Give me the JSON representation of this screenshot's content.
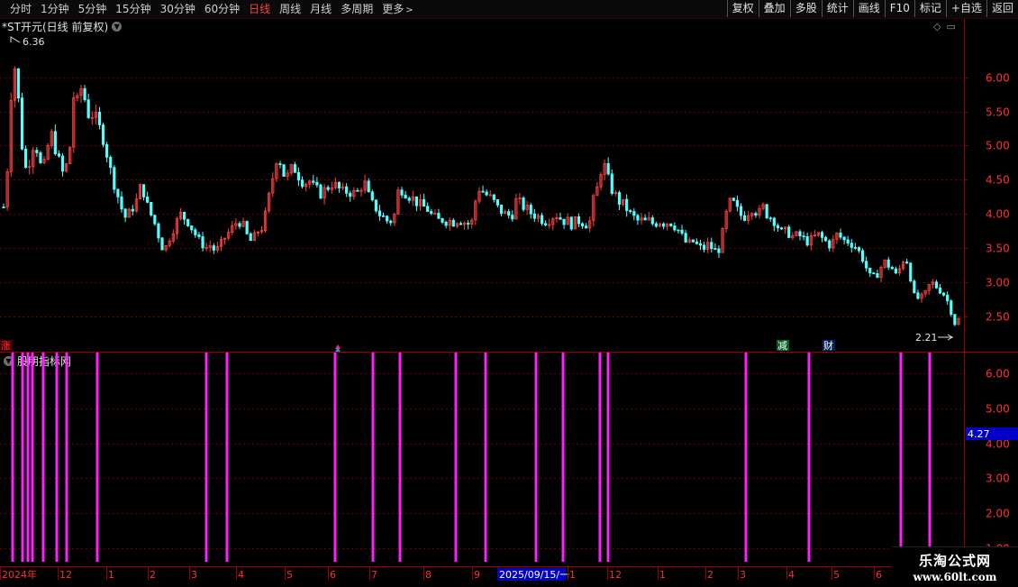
{
  "toolbar": {
    "left_items": [
      "分时",
      "1分钟",
      "5分钟",
      "15分钟",
      "30分钟",
      "60分钟",
      "日线",
      "周线",
      "月线",
      "多周期",
      "更多"
    ],
    "active_index": 6,
    "more_chevron": ">",
    "right_buttons": [
      "复权",
      "叠加",
      "多股",
      "统计",
      "画线",
      "F10",
      "标记",
      "+自选",
      "返回"
    ]
  },
  "chart_title": "*ST开元(日线 前复权)",
  "indicator_title": "股朋指标网",
  "price_axis": {
    "ticks": [
      "6.00",
      "5.50",
      "5.00",
      "4.50",
      "4.00",
      "3.50",
      "3.00",
      "2.50"
    ],
    "tick_values": [
      6.0,
      5.5,
      5.0,
      4.5,
      4.0,
      3.5,
      3.0,
      2.5
    ],
    "range": [
      2.1,
      6.75
    ]
  },
  "indicator_axis": {
    "ticks": [
      "6.00",
      "5.00",
      "4.00",
      "3.00",
      "2.00",
      "1.00"
    ],
    "tick_values": [
      6,
      5,
      4,
      3,
      2,
      1
    ],
    "range": [
      0.6,
      6.6
    ],
    "current_value": "4.27",
    "current_numeric": 4.27
  },
  "annotations": {
    "high_label": "6.36",
    "low_label": "2.21",
    "markers": [
      {
        "text": "涨",
        "color": "#ff3030",
        "bg": "#400000"
      },
      {
        "text": "减",
        "color": "#ffffff",
        "bg": "#006020"
      },
      {
        "text": "财",
        "color": "#ffffff",
        "bg": "#002060"
      }
    ]
  },
  "date_axis": {
    "labels": [
      "2024年",
      "12",
      "1",
      "2",
      "3",
      "4",
      "5",
      "6",
      "7",
      "8",
      "9",
      "2025/09/15/一",
      "1",
      "12",
      "1",
      "2",
      "3",
      "4",
      "5",
      "6"
    ]
  },
  "watermark": {
    "line1": "乐淘公式网",
    "line2": "www.60lt.com"
  },
  "colors": {
    "up": "#ff4040",
    "down": "#54ffff",
    "grid": "#6a0000",
    "signal": "#ff20ff",
    "axis_text": "#ff3030",
    "value_box": "#0000c8"
  },
  "chart_data": {
    "type": "candlestick",
    "price_series": [
      4.1,
      4.7,
      5.9,
      6.2,
      5.5,
      4.8,
      4.6,
      4.9,
      5.1,
      4.8,
      4.6,
      4.9,
      5.2,
      5.0,
      4.8,
      4.6,
      4.7,
      5.0,
      5.8,
      5.6,
      5.9,
      5.6,
      5.4,
      5.5,
      5.3,
      5.2,
      5.0,
      4.7,
      4.5,
      4.3,
      4.1,
      3.95,
      4.0,
      4.1,
      4.2,
      4.4,
      4.3,
      4.05,
      3.95,
      3.8,
      3.6,
      3.45,
      3.6,
      3.75,
      3.85,
      4.0,
      3.95,
      3.9,
      3.8,
      3.7,
      3.6,
      3.55,
      3.5,
      3.55,
      3.45,
      3.5,
      3.6,
      3.7,
      3.75,
      3.85,
      3.9,
      3.85,
      3.7,
      3.6,
      3.65,
      3.75,
      3.8,
      4.0,
      4.3,
      4.6,
      4.9,
      4.7,
      4.5,
      4.6,
      4.7,
      4.6,
      4.5,
      4.45,
      4.5,
      4.4,
      4.35,
      4.3,
      4.35,
      4.4,
      4.45,
      4.4,
      4.35,
      4.3,
      4.35,
      4.3,
      4.3,
      4.35,
      4.5,
      4.3,
      4.15,
      4.1,
      4.0,
      3.95,
      3.9,
      3.9,
      4.0,
      4.4,
      4.35,
      4.3,
      4.25,
      4.2,
      4.15,
      4.1,
      4.1,
      4.0,
      3.95,
      3.9,
      3.92,
      3.9,
      3.9,
      3.88,
      3.92,
      3.9,
      3.87,
      3.85,
      3.9,
      4.4,
      4.35,
      4.3,
      4.25,
      4.2,
      4.1,
      4.05,
      4.0,
      3.98,
      4.0,
      4.2,
      4.15,
      4.1,
      4.05,
      4.0,
      3.98,
      3.95,
      3.9,
      3.9,
      3.95,
      4.0,
      3.95,
      3.9,
      3.9,
      3.85,
      3.88,
      3.9,
      3.88,
      3.85,
      3.9,
      4.3,
      4.4,
      4.8,
      4.6,
      4.4,
      4.3,
      4.2,
      4.15,
      4.1,
      4.0,
      3.95,
      3.9,
      3.9,
      3.88,
      3.9,
      3.85,
      3.88,
      3.9,
      3.85,
      3.9,
      3.85,
      3.8,
      3.7,
      3.6,
      3.55,
      3.6,
      3.55,
      3.5,
      3.5,
      3.55,
      3.5,
      3.45,
      3.5,
      3.8,
      4.1,
      4.2,
      4.1,
      4.0,
      3.95,
      4.0,
      4.1,
      4.05,
      4.0,
      4.1,
      4.0,
      3.95,
      3.9,
      3.8,
      3.7,
      3.75,
      3.7,
      3.65,
      3.7,
      3.65,
      3.6,
      3.6,
      3.65,
      3.7,
      3.65,
      3.6,
      3.55,
      3.6,
      3.7,
      3.65,
      3.6,
      3.6,
      3.55,
      3.5,
      3.4,
      3.3,
      3.1,
      3.05,
      3.1,
      3.2,
      3.3,
      3.25,
      3.2,
      3.1,
      3.2,
      3.35,
      3.3,
      3.0,
      2.7,
      2.8,
      2.75,
      2.9,
      3.0,
      2.95,
      2.9,
      2.85,
      2.75,
      2.6,
      2.4,
      2.45
    ],
    "signal_positions": [
      14,
      25,
      31,
      36,
      48,
      63,
      74,
      108,
      229,
      252,
      372,
      414,
      444,
      506,
      539,
      595,
      625,
      666,
      675,
      828,
      898,
      1000,
      1032
    ],
    "signal_value": 6.6
  }
}
